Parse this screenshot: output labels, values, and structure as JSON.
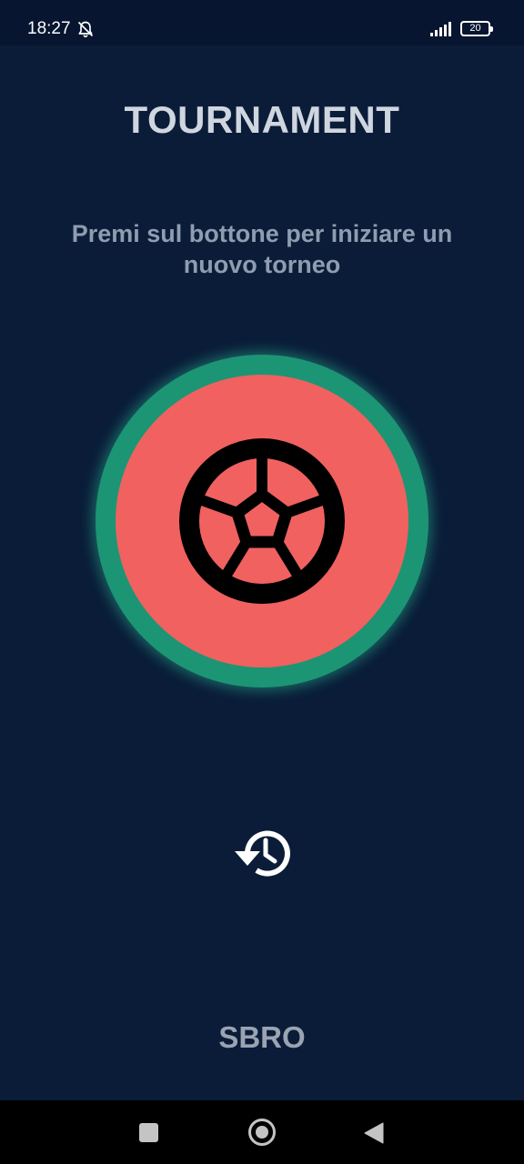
{
  "status_bar": {
    "time": "18:27",
    "battery_level": "20",
    "icons": [
      "bell-off-icon",
      "signal-icon",
      "battery-icon"
    ]
  },
  "header": {
    "title": "TOURNAMENT"
  },
  "main": {
    "instruction": "Premi sul bottone per iniziare un nuovo torneo",
    "start_button_icon": "soccer-ball-icon",
    "history_icon": "history-icon"
  },
  "footer": {
    "reset_label": "SBRO"
  },
  "nav_bar": {
    "icons": [
      "recents-icon",
      "home-icon",
      "back-icon"
    ]
  },
  "colors": {
    "background": "#0a1c38",
    "button_ring": "#1c9574",
    "button_fill": "#f06160",
    "title_text": "#cfd6df",
    "subtitle_text": "#8f9db0"
  }
}
